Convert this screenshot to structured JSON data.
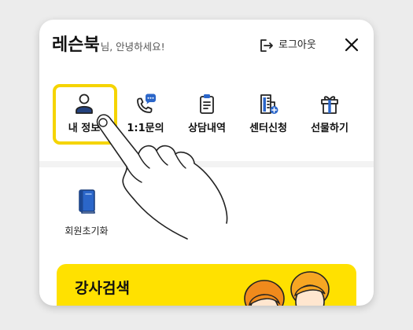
{
  "header": {
    "brand": "레슨북",
    "greeting": "님, 안녕하세요!",
    "logout_label": "로그아웃",
    "logout_icon": "logout-icon",
    "close_icon": "close-icon"
  },
  "menu": {
    "items": [
      {
        "label": "내 정보",
        "icon": "person-icon",
        "highlighted": true
      },
      {
        "label": "1:1문의",
        "icon": "phone-chat-icon"
      },
      {
        "label": "상담내역",
        "icon": "clipboard-icon"
      },
      {
        "label": "센터신청",
        "icon": "building-add-icon"
      },
      {
        "label": "선물하기",
        "icon": "gift-icon"
      }
    ]
  },
  "secondary_menu": {
    "items": [
      {
        "label": "회원초기화",
        "icon": "book-icon"
      }
    ]
  },
  "banner": {
    "title": "강사검색",
    "illustration": "instructors-illustration"
  },
  "overlay": {
    "icon": "pointing-hand-icon"
  },
  "colors": {
    "highlight": "#f5d400",
    "banner": "#ffe100",
    "accent_blue": "#2b66c9",
    "text": "#111111",
    "muted_text": "#555555"
  }
}
